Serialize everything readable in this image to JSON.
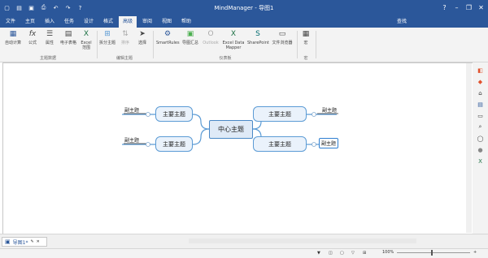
{
  "app": {
    "title": "MindManager - 导图1",
    "quick_access": [
      "new-icon",
      "open-icon",
      "save-icon",
      "print-icon",
      "undo-icon",
      "redo-icon",
      "help-icon"
    ],
    "window_buttons": [
      "help-icon",
      "minimize-icon",
      "restore-icon",
      "close-icon"
    ]
  },
  "tabs": [
    {
      "label": "文件"
    },
    {
      "label": "主页"
    },
    {
      "label": "插入"
    },
    {
      "label": "任务"
    },
    {
      "label": "设计"
    },
    {
      "label": "格式"
    },
    {
      "label": "高级",
      "active": true
    },
    {
      "label": "审阅"
    },
    {
      "label": "视图"
    },
    {
      "label": "帮助"
    }
  ],
  "search": {
    "label": "查找"
  },
  "ribbon": {
    "groups": [
      {
        "label": "主题数据",
        "buttons": [
          "自动计算",
          "公式",
          "属性",
          "电子表格",
          "Excel 范围"
        ]
      },
      {
        "label": "编辑主题",
        "buttons": [
          "拆分主题",
          "排序",
          "选择"
        ]
      },
      {
        "label": "仪表板",
        "buttons": [
          "SmartRules",
          "导图汇总",
          "Outlook",
          "Excel Data Mapper",
          "SharePoint",
          "文件浏览器"
        ]
      },
      {
        "label": "宏",
        "buttons": [
          "宏"
        ]
      }
    ]
  },
  "map": {
    "central": "中心主题",
    "main_topic_left_top": "主要主题",
    "main_topic_left_bottom": "主要主题",
    "main_topic_right_top": "主要主题",
    "main_topic_right_bottom": "主要主题",
    "sub_left_top": "副主题",
    "sub_left_bottom": "副主题",
    "sub_right_top": "副主题",
    "sub_right_bottom": "副主题"
  },
  "doc_tab": {
    "label": "导图1*"
  },
  "status": {
    "zoom": "100%"
  },
  "colors": {
    "accent": "#2b579a",
    "topic_border": "#5b9bd5",
    "topic_fill": "#eaf2fb"
  }
}
